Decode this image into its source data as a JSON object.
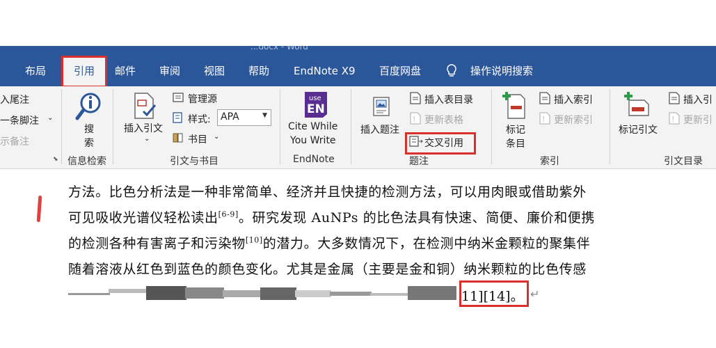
{
  "window": {
    "title": "...docx - Word"
  },
  "tabs": [
    {
      "label": "布局"
    },
    {
      "label": "引用"
    },
    {
      "label": "邮件"
    },
    {
      "label": "审阅"
    },
    {
      "label": "视图"
    },
    {
      "label": "帮助"
    },
    {
      "label": "EndNote X9"
    },
    {
      "label": "百度网盘"
    }
  ],
  "tell_me": "操作说明搜索",
  "ribbon": {
    "footnotes": {
      "insert_endnote": "入尾注",
      "next_footnote": "一条脚注",
      "show_notes": "示备注"
    },
    "research": {
      "search_line1": "搜",
      "search_line2": "索",
      "group": "信息检索"
    },
    "citations": {
      "insert_citation": "插入引文",
      "manage_sources": "管理源",
      "style_label": "样式:",
      "style_value": "APA",
      "bibliography": "书目",
      "group": "引文与书目"
    },
    "endnote": {
      "badge_top": "use",
      "badge_bottom": "EN",
      "cite_line1": "Cite While",
      "cite_line2": "You Write",
      "group": "EndNote"
    },
    "captions": {
      "insert_caption": "插入题注",
      "insert_table_of_figures": "插入表目录",
      "update_table": "更新表格",
      "cross_reference": "交叉引用",
      "group": "题注"
    },
    "index": {
      "mark_entry_line1": "标记",
      "mark_entry_line2": "条目",
      "insert_index": "插入索引",
      "update_index": "更新索引",
      "group": "索引"
    },
    "toa": {
      "mark_citation": "标记引文",
      "insert_toa": "插入引",
      "update_toa": "更新引",
      "group": "引文目录"
    }
  },
  "document": {
    "line1": "方法。比色分析法是一种非常简单、经济并且快捷的检测方法，可以用肉眼或借助紫外",
    "line2_pre": "可见吸收光谱仪轻松读出",
    "line2_sup": "[6-9]",
    "line2_post": "。研究发现 AuNPs 的比色法具有快速、简便、廉价和便携",
    "line3_pre": "的检测各种有害离子和污染物",
    "line3_sup": "[10]",
    "line3_post": "的潜力。大多数情况下，在检测中纳米金颗粒的聚集伴",
    "line4": "随着溶液从红色到蓝色的颜色变化。尤其是金属（主要是金和铜）纳米颗粒的比色传感",
    "line5_end": "11][14]。"
  },
  "colors": {
    "ribbon_blue": "#2b579a",
    "highlight_red": "#d9302c",
    "ribbon_bg": "#f3f3f3"
  }
}
